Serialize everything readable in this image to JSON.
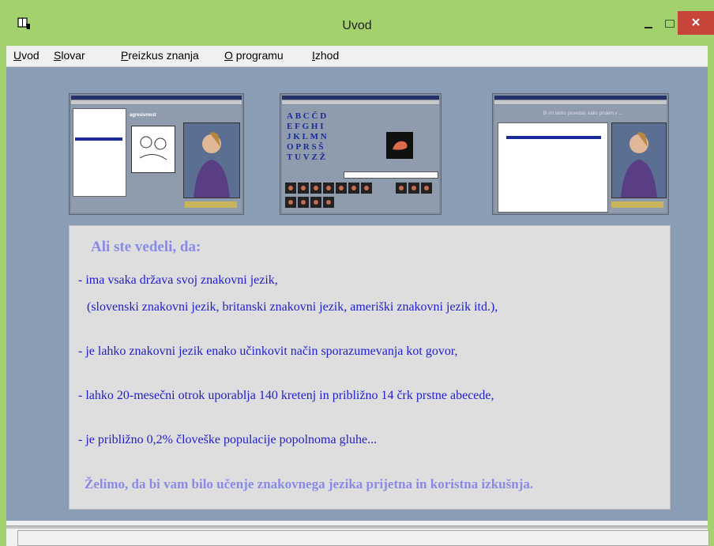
{
  "window": {
    "title": "Uvod",
    "icons": {
      "app": "book-hand-icon",
      "minimize": "minimize-icon",
      "maximize": "maximize-icon",
      "close": "close-icon"
    }
  },
  "menu": [
    {
      "label": "Uvod",
      "mnemonic": "U"
    },
    {
      "label": "Slovar",
      "mnemonic": "S"
    },
    {
      "label": "Preizkus znanja",
      "mnemonic": "P"
    },
    {
      "label": "O programu",
      "mnemonic": "O"
    },
    {
      "label": "Izhod",
      "mnemonic": "I"
    }
  ],
  "thumbnails": [
    {
      "name": "dictionary-screenshot",
      "word": "agresivnost"
    },
    {
      "name": "alphabet-screenshot",
      "letters": [
        "A",
        "B",
        "C",
        "Č",
        "D",
        "E",
        "F",
        "G",
        "H",
        "I",
        "J",
        "K",
        "L",
        "M",
        "N",
        "O",
        "P",
        "R",
        "S",
        "Š",
        "T",
        "U",
        "V",
        "Z",
        "Ž"
      ]
    },
    {
      "name": "phrases-screenshot",
      "phrase": "Bi mi lahko povedali, kako pridem v ..."
    }
  ],
  "info": {
    "heading": "Ali ste vedeli, da:",
    "facts": [
      "- ima vsaka država svoj znakovni jezik,",
      "(slovenski znakovni jezik, britanski znakovni jezik, ameriški znakovni jezik itd.),",
      "- je lahko znakovni jezik enako učinkovit način sporazumevanja kot govor,",
      "- lahko 20-mesečni otrok uporablja 140 kretenj in približno 14 črk prstne abecede,",
      "- je približno 0,2% človeške populacije popolnoma gluhe..."
    ],
    "closing": "Želimo, da bi vam bilo učenje znakovnega jezika  prijetna in koristna izkušnja."
  },
  "colors": {
    "titlebar": "#a3d16d",
    "client_background": "#8b9db5",
    "panel_background": "#dedede",
    "heading_text": "#8a8ae8",
    "fact_text": "#1e1ed0",
    "close_button": "#c7443a"
  }
}
